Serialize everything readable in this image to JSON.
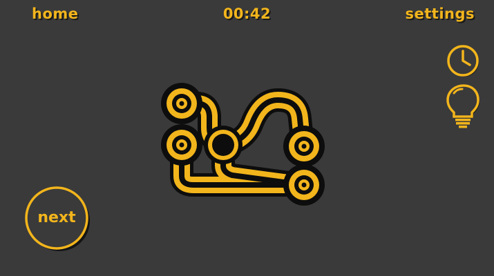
{
  "header": {
    "home_label": "home",
    "timer": "00:42",
    "settings_label": "settings"
  },
  "controls": {
    "next_label": "next",
    "clock_icon": "clock-icon",
    "hint_icon": "lightbulb-icon"
  },
  "colors": {
    "background": "#3a3a3a",
    "accent": "#f2b51c",
    "outline": "#0d0d0d"
  }
}
